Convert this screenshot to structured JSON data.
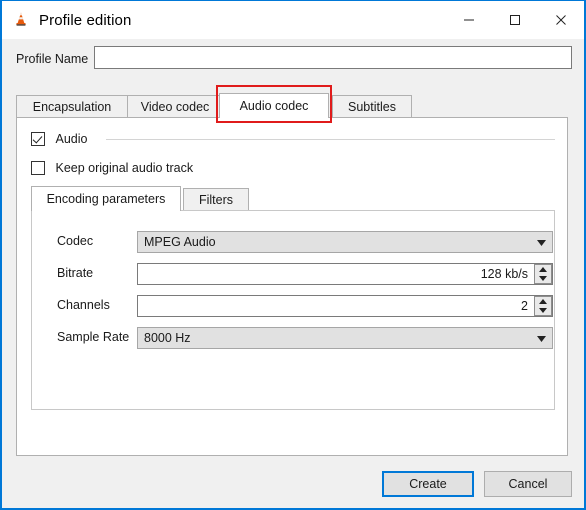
{
  "window": {
    "title": "Profile edition",
    "icon": "vlc-cone-icon",
    "controls": {
      "minimize": "minimize-icon",
      "maximize": "maximize-icon",
      "close": "close-icon"
    },
    "accent_color": "#0078d7"
  },
  "profile": {
    "label": "Profile Name",
    "value": "",
    "placeholder": ""
  },
  "tabs": [
    {
      "label": "Encapsulation",
      "active": false
    },
    {
      "label": "Video codec",
      "active": false
    },
    {
      "label": "Audio codec",
      "active": true
    },
    {
      "label": "Subtitles",
      "active": false
    }
  ],
  "highlight": {
    "target": "Audio codec",
    "color": "#e01b1b"
  },
  "audio_group": {
    "enable_label": "Audio",
    "enable_checked": true,
    "keep_original_label": "Keep original audio track",
    "keep_original_checked": false
  },
  "inner_tabs": [
    {
      "label": "Encoding parameters",
      "active": true
    },
    {
      "label": "Filters",
      "active": false
    }
  ],
  "fields": {
    "codec": {
      "label": "Codec",
      "value": "MPEG Audio",
      "type": "combobox"
    },
    "bitrate": {
      "label": "Bitrate",
      "value": "128 kb/s",
      "type": "spinbox"
    },
    "channels": {
      "label": "Channels",
      "value": "2",
      "type": "spinbox"
    },
    "sample_rate": {
      "label": "Sample Rate",
      "value": "8000 Hz",
      "type": "combobox"
    }
  },
  "buttons": {
    "create": "Create",
    "cancel": "Cancel"
  }
}
